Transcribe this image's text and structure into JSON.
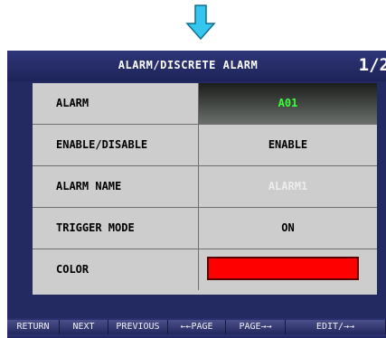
{
  "title": "ALARM/DISCRETE ALARM",
  "page_indicator": "1/2",
  "rows": [
    {
      "label": "ALARM",
      "value": "A01"
    },
    {
      "label": "ENABLE/DISABLE",
      "value": "ENABLE"
    },
    {
      "label": "ALARM NAME",
      "value": "ALARM1"
    },
    {
      "label": "TRIGGER MODE",
      "value": "ON"
    },
    {
      "label": "COLOR",
      "value": ""
    }
  ],
  "colors": {
    "alarm_value": "#37ff37",
    "color_swatch": "#ff0000",
    "screen_background": "#232a61",
    "arrow": "#35c6f0"
  },
  "nav_buttons": [
    {
      "label": "RETURN"
    },
    {
      "label": "NEXT"
    },
    {
      "label": "PREVIOUS"
    },
    {
      "label": "←←PAGE"
    },
    {
      "label": "PAGE→→"
    },
    {
      "label": "EDIT/→→"
    }
  ],
  "icons": {
    "arrow": "down-arrow-icon"
  }
}
